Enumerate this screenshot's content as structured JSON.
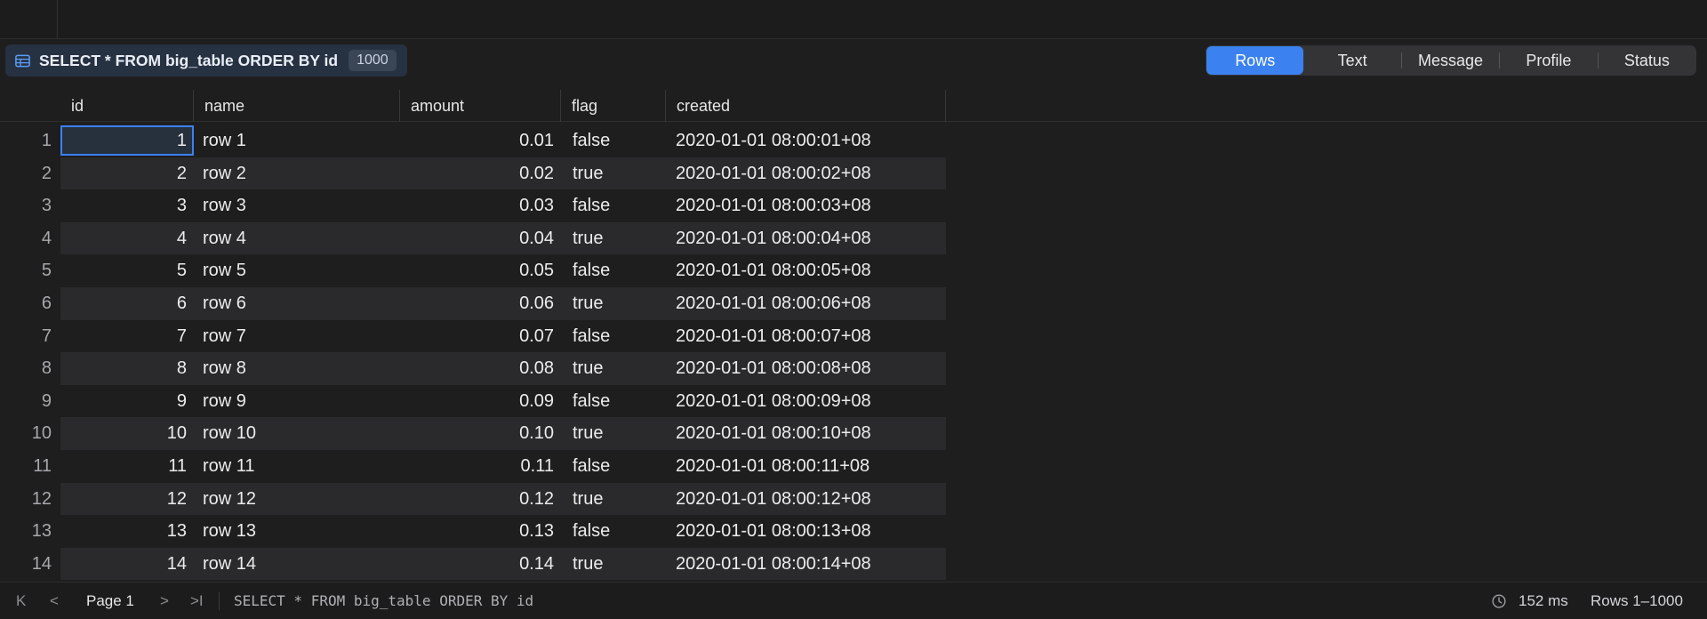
{
  "query_chip": {
    "text": "SELECT * FROM big_table ORDER BY id",
    "count": "1000"
  },
  "result_tabs": [
    {
      "label": "Rows",
      "active": true
    },
    {
      "label": "Text",
      "active": false
    },
    {
      "label": "Message",
      "active": false
    },
    {
      "label": "Profile",
      "active": false
    },
    {
      "label": "Status",
      "active": false
    }
  ],
  "columns": [
    "id",
    "name",
    "amount",
    "flag",
    "created"
  ],
  "rows": [
    {
      "n": "1",
      "id": "1",
      "name": "row 1",
      "amount": "0.01",
      "flag": "false",
      "created": "2020-01-01 08:00:01+08"
    },
    {
      "n": "2",
      "id": "2",
      "name": "row 2",
      "amount": "0.02",
      "flag": "true",
      "created": "2020-01-01 08:00:02+08"
    },
    {
      "n": "3",
      "id": "3",
      "name": "row 3",
      "amount": "0.03",
      "flag": "false",
      "created": "2020-01-01 08:00:03+08"
    },
    {
      "n": "4",
      "id": "4",
      "name": "row 4",
      "amount": "0.04",
      "flag": "true",
      "created": "2020-01-01 08:00:04+08"
    },
    {
      "n": "5",
      "id": "5",
      "name": "row 5",
      "amount": "0.05",
      "flag": "false",
      "created": "2020-01-01 08:00:05+08"
    },
    {
      "n": "6",
      "id": "6",
      "name": "row 6",
      "amount": "0.06",
      "flag": "true",
      "created": "2020-01-01 08:00:06+08"
    },
    {
      "n": "7",
      "id": "7",
      "name": "row 7",
      "amount": "0.07",
      "flag": "false",
      "created": "2020-01-01 08:00:07+08"
    },
    {
      "n": "8",
      "id": "8",
      "name": "row 8",
      "amount": "0.08",
      "flag": "true",
      "created": "2020-01-01 08:00:08+08"
    },
    {
      "n": "9",
      "id": "9",
      "name": "row 9",
      "amount": "0.09",
      "flag": "false",
      "created": "2020-01-01 08:00:09+08"
    },
    {
      "n": "10",
      "id": "10",
      "name": "row 10",
      "amount": "0.10",
      "flag": "true",
      "created": "2020-01-01 08:00:10+08"
    },
    {
      "n": "11",
      "id": "11",
      "name": "row 11",
      "amount": "0.11",
      "flag": "false",
      "created": "2020-01-01 08:00:11+08"
    },
    {
      "n": "12",
      "id": "12",
      "name": "row 12",
      "amount": "0.12",
      "flag": "true",
      "created": "2020-01-01 08:00:12+08"
    },
    {
      "n": "13",
      "id": "13",
      "name": "row 13",
      "amount": "0.13",
      "flag": "false",
      "created": "2020-01-01 08:00:13+08"
    },
    {
      "n": "14",
      "id": "14",
      "name": "row 14",
      "amount": "0.14",
      "flag": "true",
      "created": "2020-01-01 08:00:14+08"
    }
  ],
  "status_bar": {
    "first_icon": "K",
    "prev_icon": "<",
    "page_label": "Page 1",
    "next_icon": ">",
    "last_icon": ">I",
    "sql": "SELECT * FROM big_table ORDER BY id",
    "timing": "152 ms",
    "range": "Rows 1–1000"
  },
  "colors": {
    "accent": "#3b82f0",
    "background": "#1e1e1f"
  }
}
